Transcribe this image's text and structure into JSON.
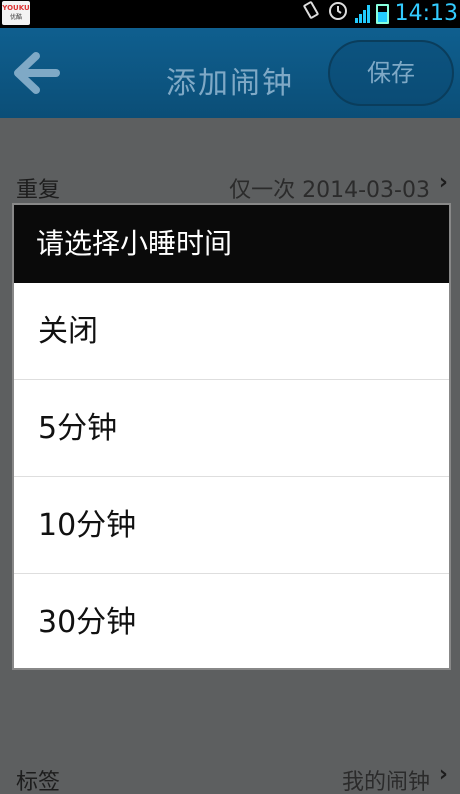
{
  "status_bar": {
    "app_logo": "YOUKU",
    "app_logo_sub": "优酷",
    "time": "14:13"
  },
  "header": {
    "title": "添加闹钟",
    "save_label": "保存"
  },
  "background_rows": [
    {
      "label": "重复",
      "value": "仅一次 2014-03-03"
    },
    {
      "label": "标签",
      "value": "我的闹钟"
    }
  ],
  "dialog": {
    "title": "请选择小睡时间",
    "options": [
      "关闭",
      "5分钟",
      "10分钟",
      "30分钟"
    ]
  },
  "colors": {
    "title_bar": "#0f5f8f",
    "dialog_header": "#0a0a0a",
    "clock": "#33ccff"
  }
}
